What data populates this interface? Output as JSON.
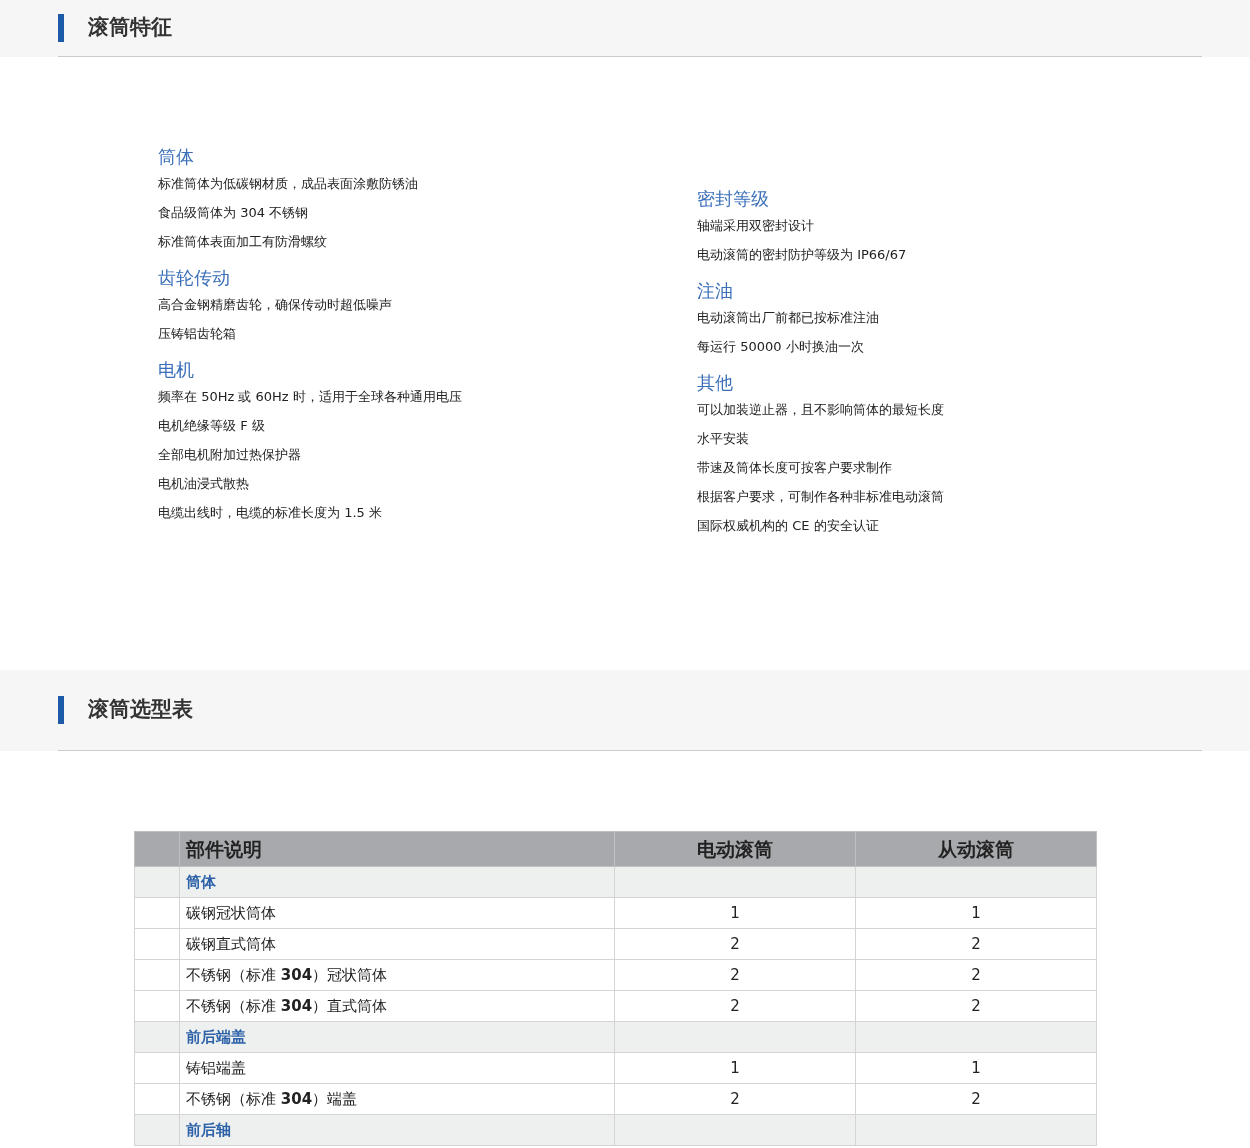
{
  "sections": [
    {
      "kind": "features",
      "title": "滚筒特征",
      "columns": [
        [
          {
            "heading": "筒体",
            "items": [
              "标准筒体为低碳钢材质，成品表面涂敷防锈油",
              "食品级筒体为 304 不锈钢",
              "标准筒体表面加工有防滑螺纹"
            ]
          },
          {
            "heading": "齿轮传动",
            "items": [
              "高合金钢精磨齿轮，确保传动时超低噪声",
              "压铸铝齿轮箱"
            ]
          },
          {
            "heading": "电机",
            "items": [
              "频率在 50Hz 或 60Hz 时，适用于全球各种通用电压",
              "电机绝缘等级 F 级",
              "全部电机附加过热保护器",
              "电机油浸式散热",
              "电缆出线时，电缆的标准长度为 1.5 米"
            ]
          }
        ],
        [
          {
            "heading": "密封等级",
            "items": [
              "轴端采用双密封设计",
              "电动滚筒的密封防护等级为 IP66/67"
            ]
          },
          {
            "heading": "注油",
            "items": [
              "电动滚筒出厂前都已按标准注油",
              "每运行 50000 小时换油一次"
            ]
          },
          {
            "heading": "其他",
            "items": [
              "可以加装逆止器，且不影响筒体的最短长度",
              "水平安装",
              "带速及筒体长度可按客户要求制作",
              "根据客户要求，可制作各种非标准电动滚筒",
              "国际权威机构的 CE 的安全认证"
            ]
          }
        ]
      ]
    },
    {
      "kind": "table",
      "title": "滚筒选型表",
      "columns": [
        "部件说明",
        "电动滚筒",
        "从动滚筒"
      ],
      "rows": [
        {
          "kind": "group",
          "cells": [
            "筒体"
          ]
        },
        {
          "kind": "item",
          "cells": [
            "碳钢冠状筒体",
            "1",
            "1"
          ]
        },
        {
          "kind": "item",
          "cells": [
            "碳钢直式筒体",
            "2",
            "2"
          ]
        },
        {
          "kind": "item",
          "cells": [
            "不锈钢（标准 **304**）冠状筒体",
            "2",
            "2"
          ]
        },
        {
          "kind": "item",
          "cells": [
            "不锈钢（标准 **304**）直式筒体",
            "2",
            "2"
          ]
        },
        {
          "kind": "group",
          "cells": [
            "前后端盖"
          ]
        },
        {
          "kind": "item",
          "cells": [
            "铸铝端盖",
            "1",
            "1"
          ]
        },
        {
          "kind": "item",
          "cells": [
            "不锈钢（标准 **304**）端盖",
            "2",
            "2"
          ]
        },
        {
          "kind": "group",
          "cells": [
            "前后轴"
          ]
        }
      ]
    }
  ]
}
